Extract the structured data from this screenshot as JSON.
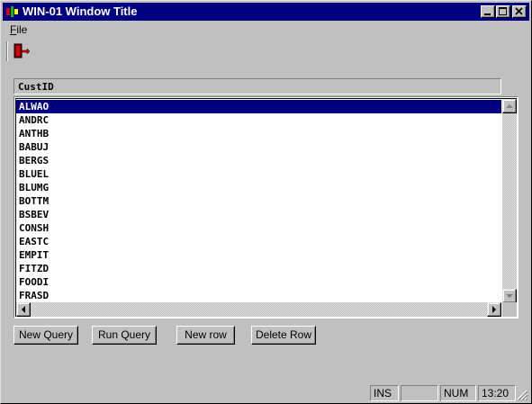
{
  "window": {
    "title": "WIN-01 Window Title"
  },
  "menu": {
    "file_prefix": "F",
    "file_rest": "ile"
  },
  "toolbar": {
    "exit_icon": "exit-door-icon"
  },
  "list": {
    "header": "CustID",
    "selected_index": 0,
    "items": [
      "ALWAO",
      "ANDRC",
      "ANTHB",
      "BABUJ",
      "BERGS",
      "BLUEL",
      "BLUMG",
      "BOTTM",
      "BSBEV",
      "CONSH",
      "EASTC",
      "EMPIT",
      "FITZD",
      "FOODI",
      "FRASD"
    ]
  },
  "buttons": {
    "new_query": "New Query",
    "run_query": "Run Query",
    "new_row": "New row",
    "delete_row": "Delete Row"
  },
  "status": {
    "ins": "INS",
    "blank": "",
    "num": "NUM",
    "time": "13:20"
  },
  "colors": {
    "titlebar": "#000080",
    "selection": "#000080",
    "face": "#c0c0c0"
  }
}
